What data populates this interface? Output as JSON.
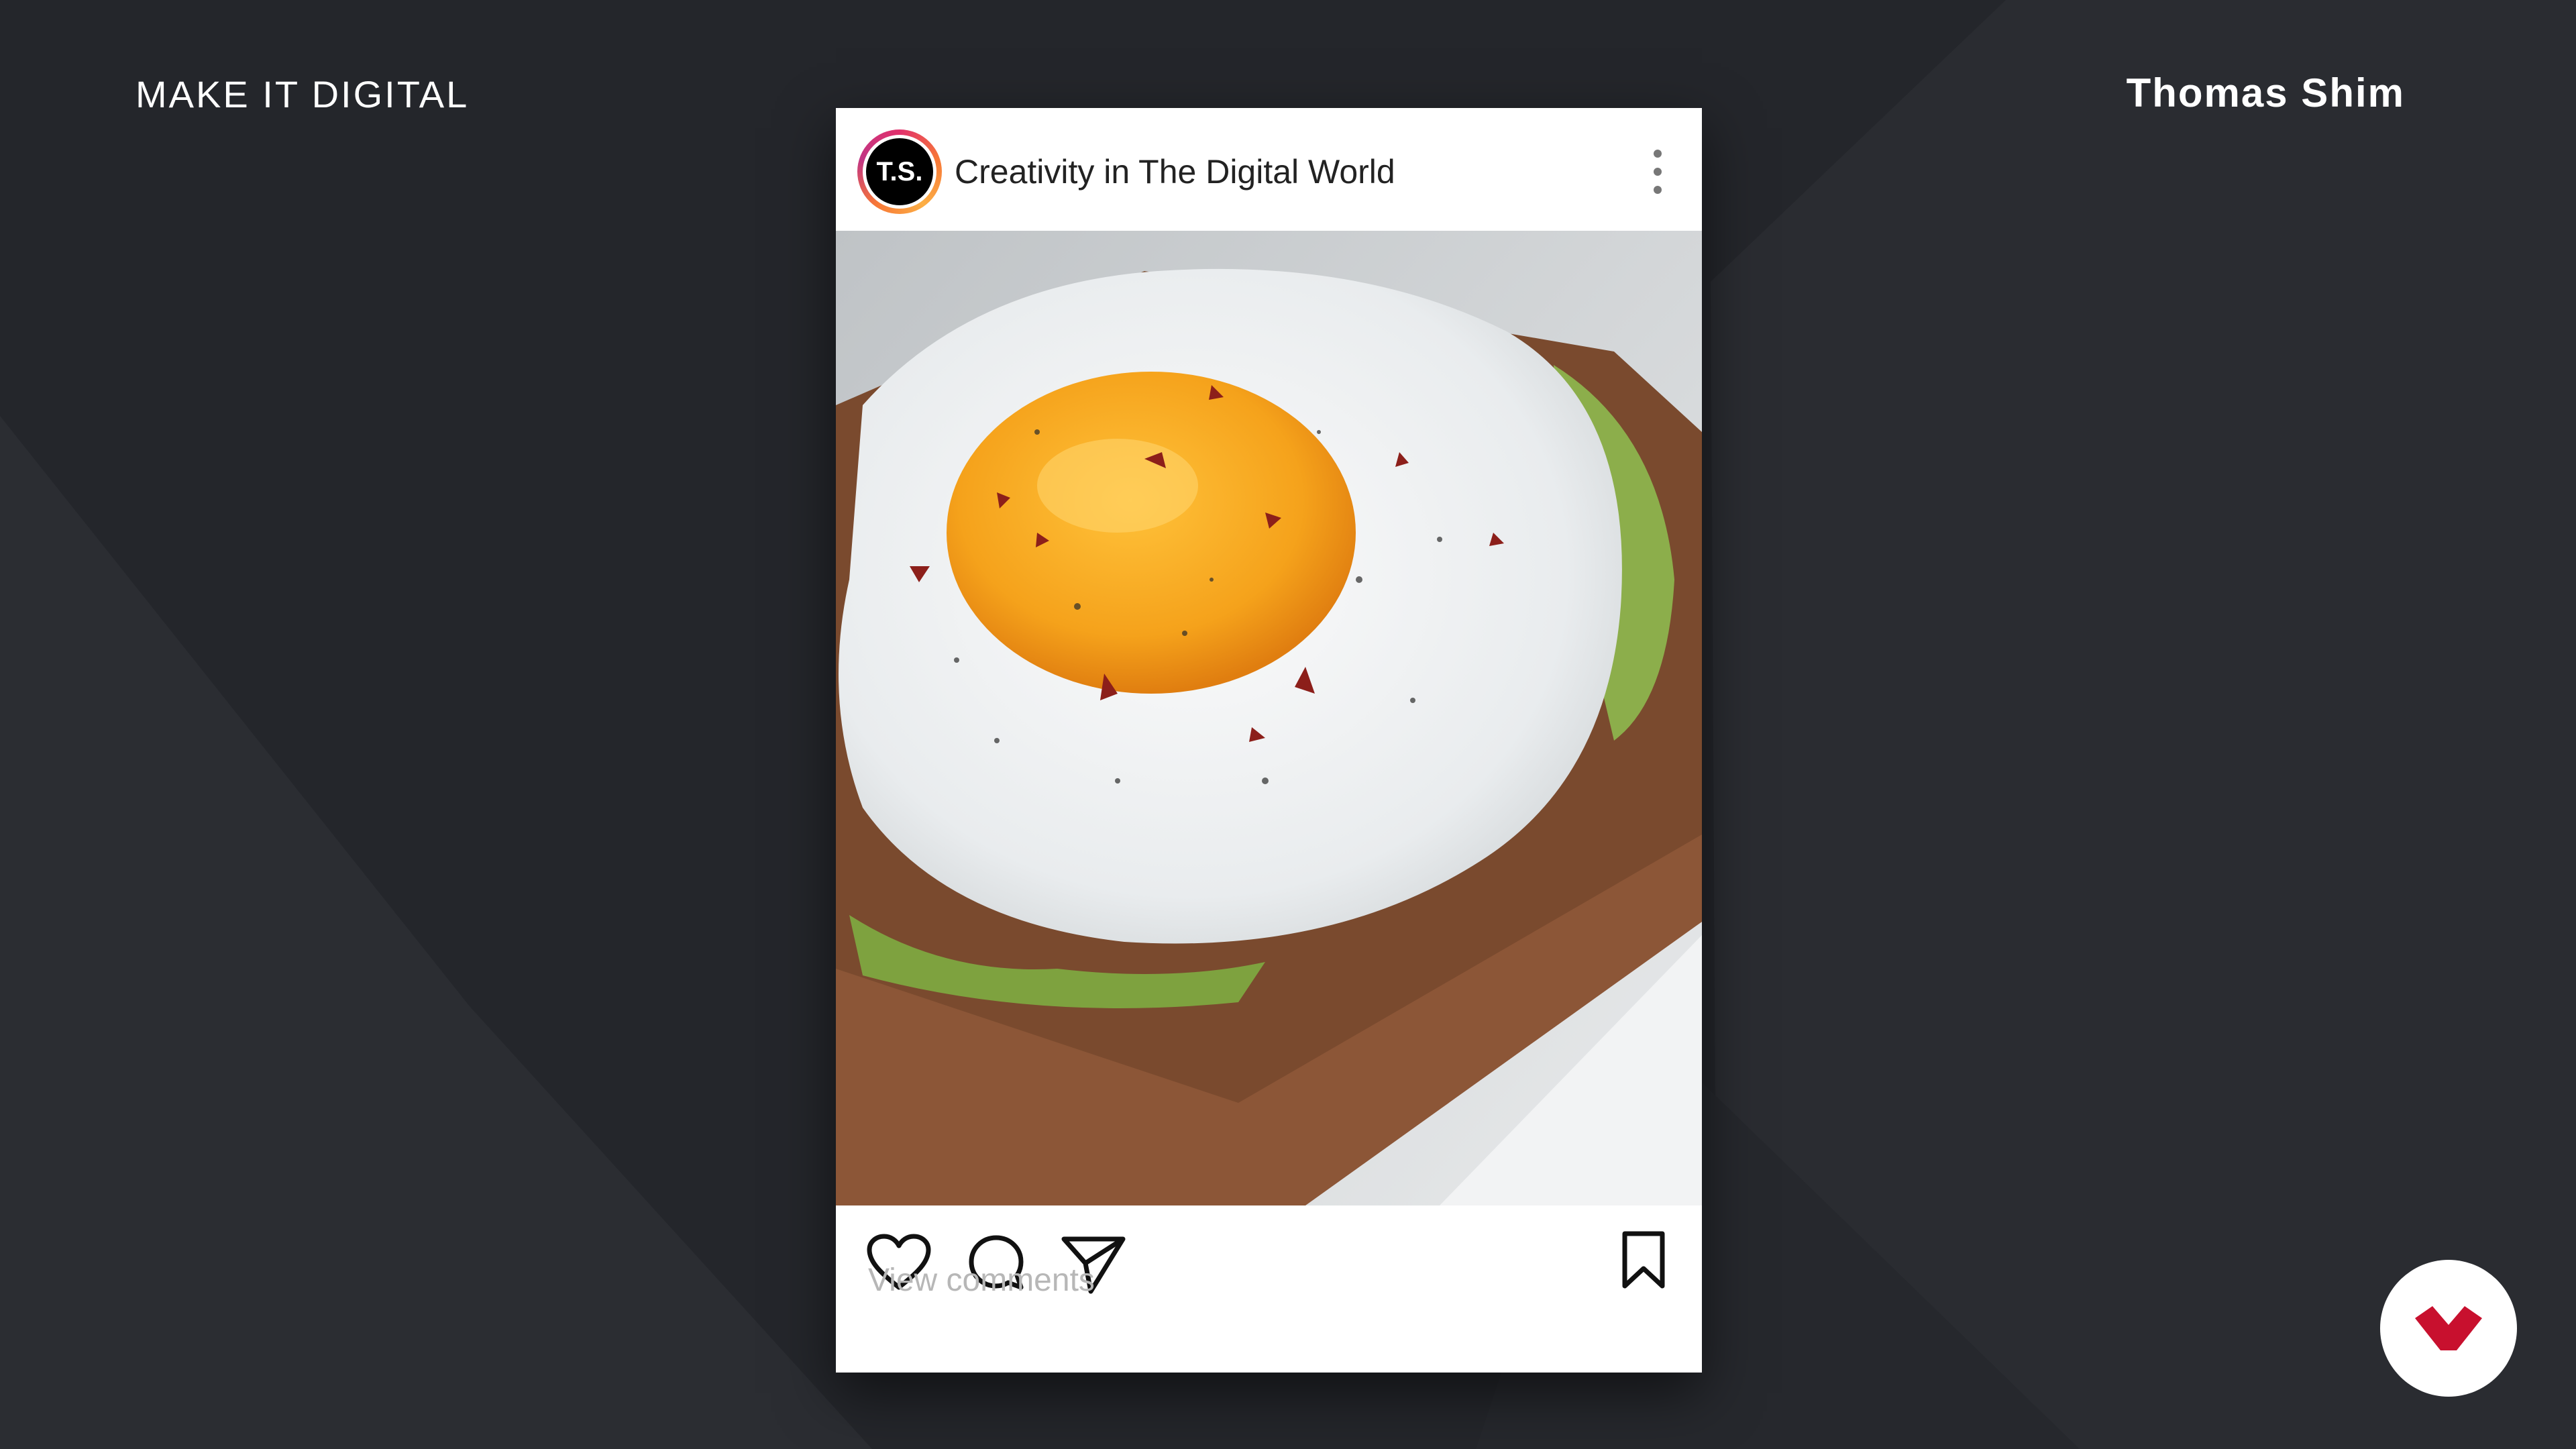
{
  "header": {
    "brand": "MAKE IT DIGITAL",
    "author": "Thomas Shim"
  },
  "post": {
    "avatar_text": "T.S.",
    "account_name": "Creativity in The Digital World",
    "comments_link": "View comments",
    "photo_subject": "fried egg on avocado toast"
  },
  "icons": {
    "more": "more-vertical-icon",
    "like": "heart-icon",
    "comment": "comment-bubble-icon",
    "share": "send-icon",
    "save": "bookmark-icon",
    "logo": "brand-logo-icon"
  },
  "colors": {
    "background": "#24262b",
    "card": "#ffffff",
    "accent_red": "#c8102e",
    "muted_text": "#b7b7b7"
  }
}
